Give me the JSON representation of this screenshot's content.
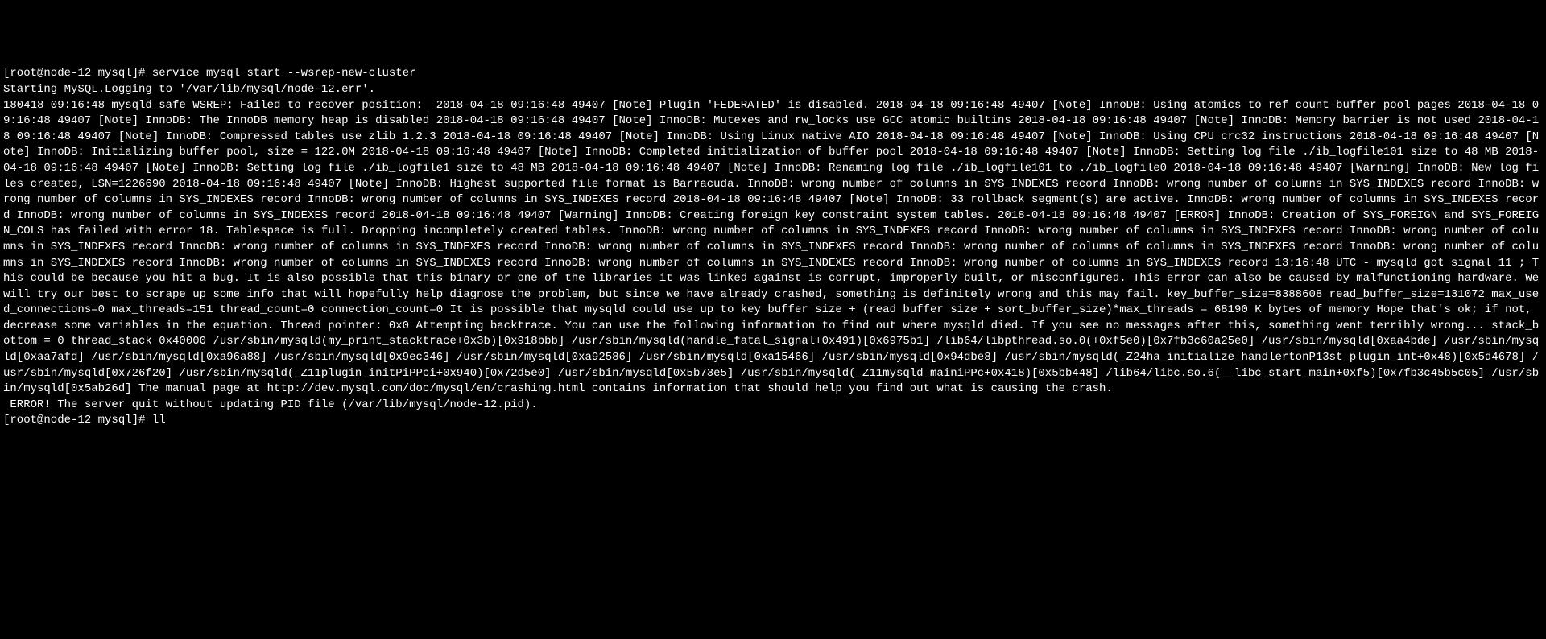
{
  "terminal": {
    "prompt1": "[root@node-12 mysql]# ",
    "command1": "service mysql start --wsrep-new-cluster",
    "line2": "Starting MySQL.Logging to '/var/lib/mysql/node-12.err'.",
    "body": "180418 09:16:48 mysqld_safe WSREP: Failed to recover position:  2018-04-18 09:16:48 49407 [Note] Plugin 'FEDERATED' is disabled. 2018-04-18 09:16:48 49407 [Note] InnoDB: Using atomics to ref count buffer pool pages 2018-04-18 09:16:48 49407 [Note] InnoDB: The InnoDB memory heap is disabled 2018-04-18 09:16:48 49407 [Note] InnoDB: Mutexes and rw_locks use GCC atomic builtins 2018-04-18 09:16:48 49407 [Note] InnoDB: Memory barrier is not used 2018-04-18 09:16:48 49407 [Note] InnoDB: Compressed tables use zlib 1.2.3 2018-04-18 09:16:48 49407 [Note] InnoDB: Using Linux native AIO 2018-04-18 09:16:48 49407 [Note] InnoDB: Using CPU crc32 instructions 2018-04-18 09:16:48 49407 [Note] InnoDB: Initializing buffer pool, size = 122.0M 2018-04-18 09:16:48 49407 [Note] InnoDB: Completed initialization of buffer pool 2018-04-18 09:16:48 49407 [Note] InnoDB: Setting log file ./ib_logfile101 size to 48 MB 2018-04-18 09:16:48 49407 [Note] InnoDB: Setting log file ./ib_logfile1 size to 48 MB 2018-04-18 09:16:48 49407 [Note] InnoDB: Renaming log file ./ib_logfile101 to ./ib_logfile0 2018-04-18 09:16:48 49407 [Warning] InnoDB: New log files created, LSN=1226690 2018-04-18 09:16:48 49407 [Note] InnoDB: Highest supported file format is Barracuda. InnoDB: wrong number of columns in SYS_INDEXES record InnoDB: wrong number of columns in SYS_INDEXES record InnoDB: wrong number of columns in SYS_INDEXES record InnoDB: wrong number of columns in SYS_INDEXES record 2018-04-18 09:16:48 49407 [Note] InnoDB: 33 rollback segment(s) are active. InnoDB: wrong number of columns in SYS_INDEXES record InnoDB: wrong number of columns in SYS_INDEXES record 2018-04-18 09:16:48 49407 [Warning] InnoDB: Creating foreign key constraint system tables. 2018-04-18 09:16:48 49407 [ERROR] InnoDB: Creation of SYS_FOREIGN and SYS_FOREIGN_COLS has failed with error 18. Tablespace is full. Dropping incompletely created tables. InnoDB: wrong number of columns in SYS_INDEXES record InnoDB: wrong number of columns in SYS_INDEXES record InnoDB: wrong number of columns in SYS_INDEXES record InnoDB: wrong number of columns in SYS_INDEXES record InnoDB: wrong number of columns in SYS_INDEXES record InnoDB: wrong number of columns of columns in SYS_INDEXES record InnoDB: wrong number of columns in SYS_INDEXES record InnoDB: wrong number of columns in SYS_INDEXES record InnoDB: wrong number of columns in SYS_INDEXES record InnoDB: wrong number of columns in SYS_INDEXES record 13:16:48 UTC - mysqld got signal 11 ; This could be because you hit a bug. It is also possible that this binary or one of the libraries it was linked against is corrupt, improperly built, or misconfigured. This error can also be caused by malfunctioning hardware. We will try our best to scrape up some info that will hopefully help diagnose the problem, but since we have already crashed, something is definitely wrong and this may fail. key_buffer_size=8388608 read_buffer_size=131072 max_used_connections=0 max_threads=151 thread_count=0 connection_count=0 It is possible that mysqld could use up to key buffer size + (read buffer size + sort_buffer_size)*max_threads = 68190 K bytes of memory Hope that's ok; if not, decrease some variables in the equation. Thread pointer: 0x0 Attempting backtrace. You can use the following information to find out where mysqld died. If you see no messages after this, something went terribly wrong... stack_bottom = 0 thread_stack 0x40000 /usr/sbin/mysqld(my_print_stacktrace+0x3b)[0x918bbb] /usr/sbin/mysqld(handle_fatal_signal+0x491)[0x6975b1] /lib64/libpthread.so.0(+0xf5e0)[0x7fb3c60a25e0] /usr/sbin/mysqld[0xaa4bde] /usr/sbin/mysqld[0xaa7afd] /usr/sbin/mysqld[0xa96a88] /usr/sbin/mysqld[0x9ec346] /usr/sbin/mysqld[0xa92586] /usr/sbin/mysqld[0xa15466] /usr/sbin/mysqld[0x94dbe8] /usr/sbin/mysqld(_Z24ha_initialize_handlertonP13st_plugin_int+0x48)[0x5d4678] /usr/sbin/mysqld[0x726f20] /usr/sbin/mysqld(_Z11plugin_initPiPPci+0x940)[0x72d5e0] /usr/sbin/mysqld[0x5b73e5] /usr/sbin/mysqld(_Z11mysqld_mainiPPc+0x418)[0x5bb448] /lib64/libc.so.6(__libc_start_main+0xf5)[0x7fb3c45b5c05] /usr/sbin/mysqld[0x5ab26d] The manual page at http://dev.mysql.com/doc/mysql/en/crashing.html contains information that should help you find out what is causing the crash.",
    "error_line": " ERROR! The server quit without updating PID file (/var/lib/mysql/node-12.pid).",
    "prompt2": "[root@node-12 mysql]# ",
    "command2": "ll"
  }
}
